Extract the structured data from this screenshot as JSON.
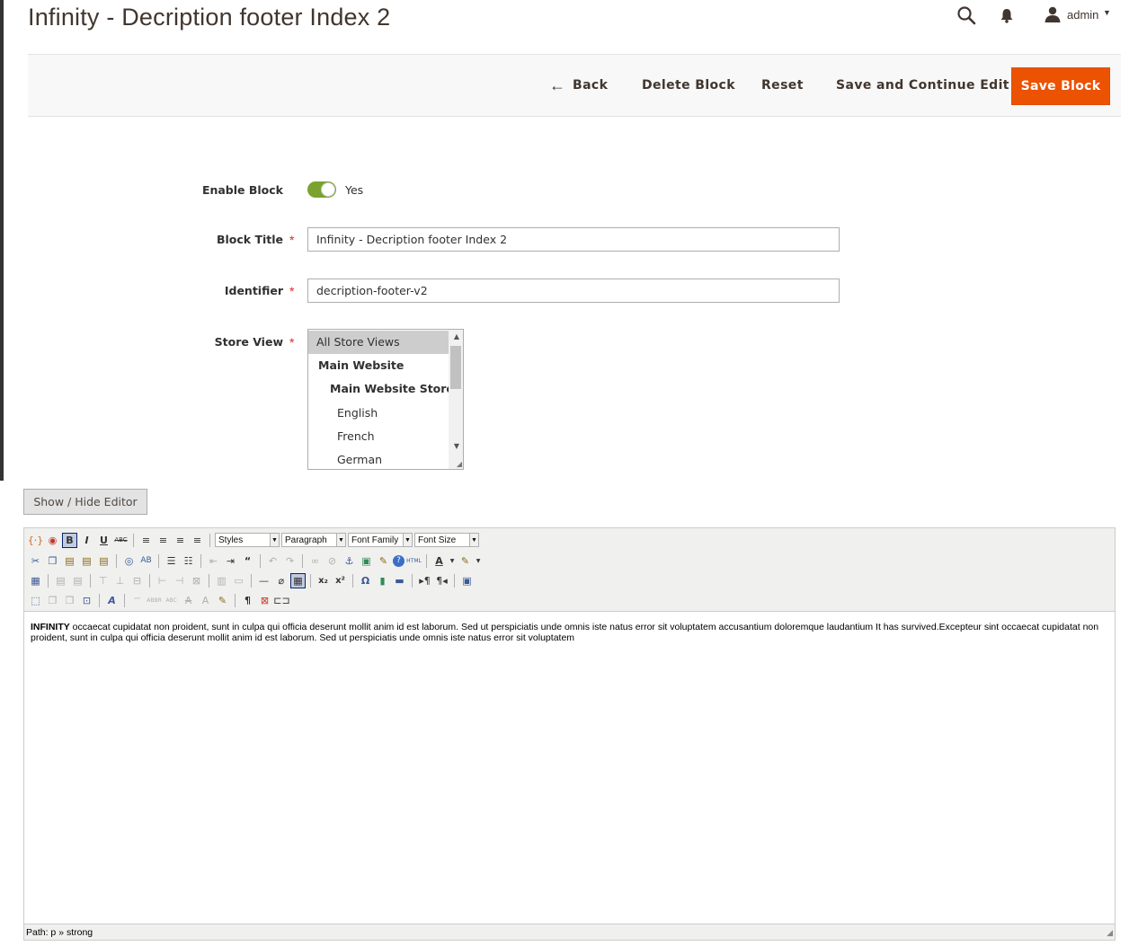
{
  "page": {
    "title": "Infinity - Decription footer Index 2"
  },
  "header": {
    "user_name": "admin",
    "icons": [
      "search-icon",
      "bell-icon",
      "user-icon"
    ]
  },
  "actions": {
    "back": "Back",
    "delete": "Delete Block",
    "reset": "Reset",
    "save_continue": "Save and Continue Edit",
    "save": "Save Block"
  },
  "form": {
    "enable_label": "Enable Block",
    "enable_value": "Yes",
    "title_label": "Block Title",
    "title_value": "Infinity - Decription footer Index 2",
    "identifier_label": "Identifier",
    "identifier_value": "decription-footer-v2",
    "store_label": "Store View",
    "store_options": [
      "All Store Views",
      "Main Website",
      "Main Website Store",
      "English",
      "French",
      "German"
    ],
    "store_selected": "All Store Views"
  },
  "editor": {
    "toggle_label": "Show / Hide Editor",
    "dropdowns": [
      "Styles",
      "Paragraph",
      "Font Family",
      "Font Size"
    ],
    "content_strong": "INFINITY",
    "content_text": " occaecat cupidatat non proident, sunt in culpa qui officia deserunt mollit anim id est laborum. Sed ut perspiciatis unde omnis iste natus error sit voluptatem accusantium doloremque laudantium It has survived.Excepteur sint occaecat cupidatat non proident, sunt in culpa qui officia deserunt mollit anim id est laborum. Sed ut perspiciatis unde omnis iste natus error sit voluptatem",
    "path": "Path: p » strong"
  },
  "colors": {
    "accent": "#eb5202",
    "toggle_on": "#79a22e",
    "required": "#e22626"
  }
}
